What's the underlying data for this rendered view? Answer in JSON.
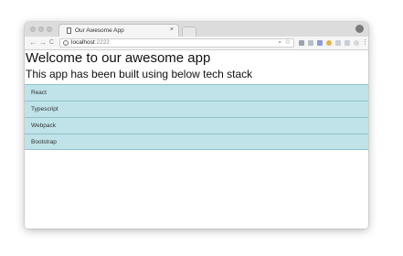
{
  "browser": {
    "tab_title": "Our Awesome App",
    "tab_close": "×",
    "url_host": "localhost",
    "url_port": ":2222",
    "nav": {
      "back": "←",
      "forward": "→",
      "reload": "C"
    },
    "info_icon": "i",
    "zoom_icon": "🔍",
    "bookmark_icon": "☆",
    "overflow_icon": "⋮"
  },
  "page": {
    "heading": "Welcome to our awesome app",
    "subheading": "This app has been built using below tech stack",
    "stack_items": [
      {
        "label": "React"
      },
      {
        "label": "Typescript"
      },
      {
        "label": "Webpack"
      },
      {
        "label": "Bootstrap"
      }
    ]
  },
  "colors": {
    "list_item_bg": "#bfe3e9",
    "list_item_border": "#8fc2cb"
  }
}
